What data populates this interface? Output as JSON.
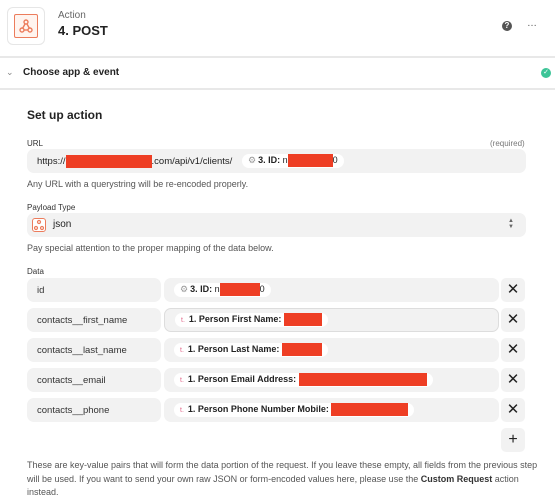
{
  "header": {
    "subtitle": "Action",
    "title": "4. POST",
    "help_icon": "?",
    "more_icon": "…"
  },
  "section": {
    "title": "Choose app & event",
    "status": "complete"
  },
  "setup": {
    "title": "Set up action",
    "url": {
      "label": "URL",
      "required": "(required)",
      "prefix": "https://",
      "middle": ".com/api/v1/clients/",
      "pill_label": "3. ID:",
      "pill_prefix": "n",
      "pill_suffix": "0",
      "help": "Any URL with a querystring will be re-encoded properly."
    },
    "payload": {
      "label": "Payload Type",
      "value": "json",
      "help": "Pay special attention to the proper mapping of the data below."
    },
    "data": {
      "label": "Data",
      "rows": [
        {
          "key": "id",
          "pill_label": "3. ID:",
          "pill_prefix": "n",
          "pill_suffix": "0",
          "icon": "gear"
        },
        {
          "key": "contacts__first_name",
          "pill_label": "1. Person First Name:",
          "icon": "text"
        },
        {
          "key": "contacts__last_name",
          "pill_label": "1. Person Last Name:",
          "icon": "text"
        },
        {
          "key": "contacts__email",
          "pill_label": "1. Person Email Address:",
          "icon": "text"
        },
        {
          "key": "contacts__phone",
          "pill_label": "1. Person Phone Number Mobile:",
          "icon": "text"
        }
      ],
      "remove_icon": "✕",
      "add_icon": "+"
    },
    "footer": {
      "text1": "These are key-value pairs that will form the data portion of the request. If you leave these empty, all fields from the previous step will be used. If you want to send your own raw JSON or form-encoded values here, please use the ",
      "bold1": "Custom",
      "bold2": "Request",
      "text2": " action instead."
    }
  },
  "colors": {
    "accent": "#ec7c5c",
    "redaction": "#ee3e24",
    "success": "#3cc497"
  }
}
